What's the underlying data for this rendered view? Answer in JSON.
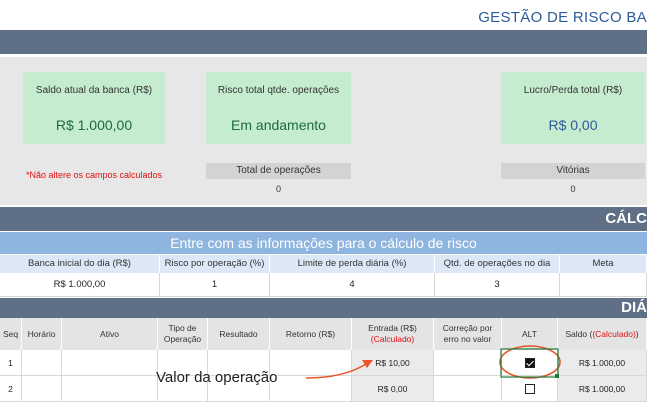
{
  "page": {
    "title": "GESTÃO DE RISCO BA"
  },
  "summary": {
    "saldo_label": "Saldo atual da banca (R$)",
    "saldo_value": "R$ 1.000,00",
    "risco_label": "Risco total qtde. operações",
    "risco_value": "Em andamento",
    "lucro_label": "Lucro/Perda total (R$)",
    "lucro_value": "R$ 0,00",
    "warning": "*Não altere os campos calculados",
    "total_ops_label": "Total de operações",
    "total_ops_value": "0",
    "vitorias_label": "Vitórias",
    "vitorias_value": "0"
  },
  "calc_section": {
    "band_label": "CÁLC",
    "info_title": "Entre com as informações para o cálculo de risco",
    "headers": [
      "Banca inicial do dia (R$)",
      "Risco por operação (%)",
      "Limite de perda diária (%)",
      "Qtd. de operações no dia",
      "Meta"
    ],
    "values": [
      "R$ 1.000,00",
      "1",
      "4",
      "3",
      ""
    ]
  },
  "daily_section": {
    "band_label": "DIÁ",
    "headers": {
      "seq": "Seq",
      "horario": "Horário",
      "ativo": "Ativo",
      "tipo_line1": "Tipo de",
      "tipo_line2": "Operação",
      "resultado": "Resultado",
      "retorno": "Retorno (R$)",
      "entrada_line1": "Entrada (R$)",
      "entrada_calc": "(Calculado)",
      "correcao_line1": "Correção por",
      "correcao_line2": "erro no valor",
      "alt": "ALT",
      "saldo": "Saldo",
      "saldo_calc": "(Calculado)"
    },
    "rows": [
      {
        "seq": "1",
        "entrada": "R$ 10,00",
        "alt_checked": true,
        "saldo": "R$ 1.000,00"
      },
      {
        "seq": "2",
        "entrada": "R$ 0,00",
        "alt_checked": false,
        "saldo": "R$ 1.000,00"
      }
    ]
  },
  "annotation": {
    "text": "Valor da operação"
  },
  "colors": {
    "band": "#5f6f85",
    "info_bar": "#8eb4e0",
    "card": "#c6ecd0",
    "accent_red": "#e01010",
    "title_blue": "#2e5b9a"
  }
}
